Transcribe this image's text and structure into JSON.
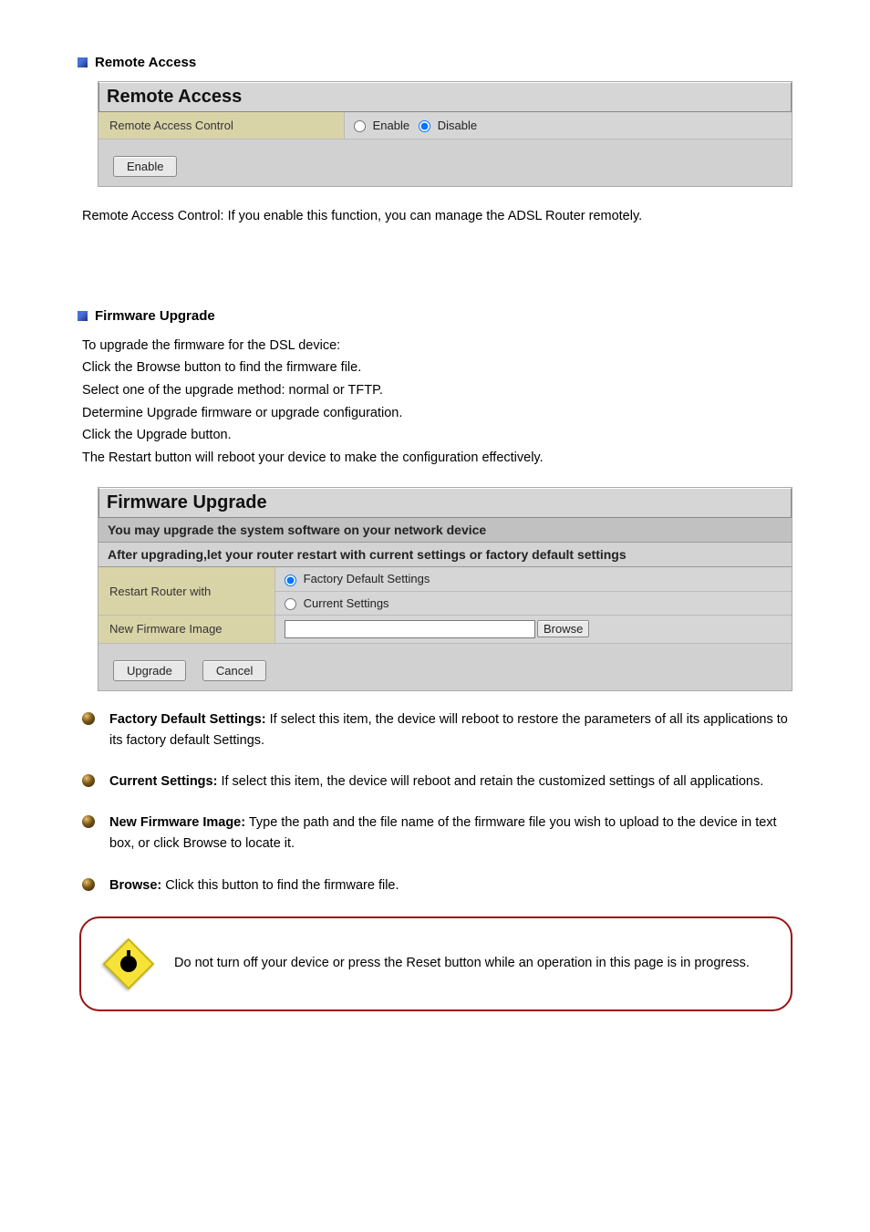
{
  "sections": {
    "remote_access": {
      "heading": "Remote Access",
      "panel_title": "Remote Access",
      "row_label": "Remote Access Control",
      "option_enable": "Enable",
      "option_disable": "Disable",
      "button_enable": "Enable",
      "description": "Remote Access Control: If you enable this function, you can manage the ADSL Router remotely."
    },
    "firmware_upgrade": {
      "heading": "Firmware Upgrade",
      "intro1": "To upgrade the firmware for the DSL device:",
      "intro2": "Click the Browse button to find the firmware file.",
      "intro3": "Select one of the upgrade method: normal or TFTP.",
      "intro4": "Determine Upgrade firmware or upgrade configuration.",
      "intro5": "Click the Upgrade button.",
      "intro6": "The Restart button will reboot your device to make the configuration effectively.",
      "panel_title": "Firmware Upgrade",
      "info_bar1": "You may upgrade the system software on your network device",
      "info_bar2": "After upgrading,let your router restart with current settings or factory default settings",
      "restart_label": "Restart Router with",
      "opt_factory": "Factory Default Settings",
      "opt_current": "Current Settings",
      "new_fw_label": "New Firmware Image",
      "browse_btn": "Browse",
      "upgrade_btn": "Upgrade",
      "cancel_btn": "Cancel",
      "bullets": [
        {
          "label": "Factory Default Settings:",
          "text": " If select this item, the device will reboot to restore the parameters of all its applications to its factory default Settings."
        },
        {
          "label": "Current Settings:",
          "text": " If select this item, the device will reboot and retain the customized settings of all applications."
        },
        {
          "label": "New Firmware Image:",
          "text": " Type the path and the file name of the firmware file you wish to upload to the device in text box, or click Browse to locate it."
        },
        {
          "label": "Browse: ",
          "text": "Click this button to find the firmware file."
        }
      ],
      "caution": "Do not turn off your device or press the Reset button while an operation in this page is in progress."
    }
  }
}
